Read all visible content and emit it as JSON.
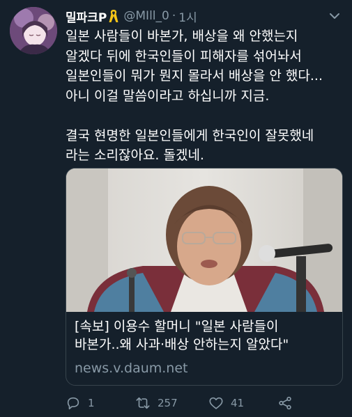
{
  "tweet": {
    "display_name": "밀파크P",
    "handle": "@MIll_0",
    "separator": "·",
    "time": "1시",
    "lines": [
      "일본 사람들이 바본가, 배상을 왜 안했는지",
      "알겠다 뒤에 한국인들이 피해자를 섞어놔서",
      "일본인들이 뭐가 뭔지 몰라서 배상을 안 했다...",
      "아니 이걸 말씀이라고 하십니까 지금.",
      "",
      "결국 현명한 일본인들에게 한국인이 잘못했네",
      "라는 소리잖아요. 돌겠네."
    ]
  },
  "card": {
    "title_lines": [
      "[속보] 이용수 할머니 \"일본 사람들이",
      "바본가..왜 사과·배상 안하는지 알았다\""
    ],
    "domain": "news.v.daum.net"
  },
  "actions": {
    "reply_count": "1",
    "retweet_count": "257",
    "like_count": "41"
  },
  "colors": {
    "background": "#15202b",
    "secondary_text": "#8899a6",
    "border": "#38444d",
    "ribbon": "#f5c518"
  }
}
